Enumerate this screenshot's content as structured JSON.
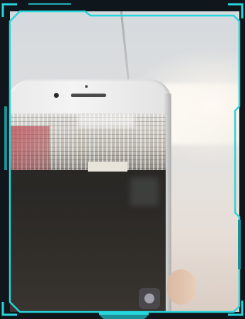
{
  "image": {
    "subject": "phone-camera-photo"
  },
  "hud": {
    "frame_color": "#27d5dc",
    "frame_dark": "#0f3a3f",
    "background": "#0f171d"
  }
}
